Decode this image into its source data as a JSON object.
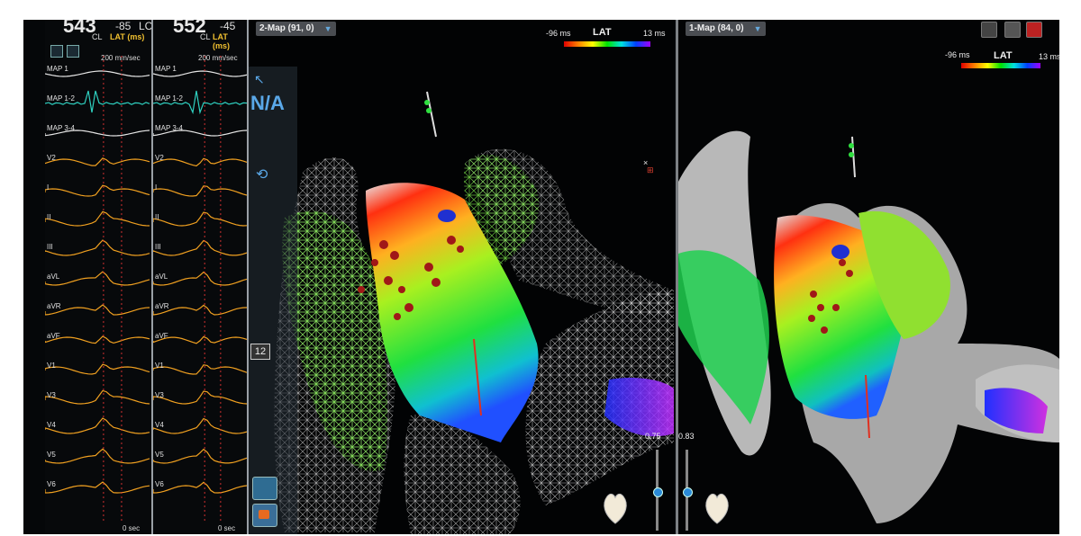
{
  "ecg_left": {
    "big": "543",
    "small": "-85",
    "extra": "LC",
    "cl": "CL",
    "lat": "LAT (ms)",
    "speed": "200 mm/sec",
    "leads": [
      "MAP 1",
      "MAP 1-2",
      "MAP 3-4",
      "V2",
      "I",
      "II",
      "III",
      "aVL",
      "aVR",
      "aVF",
      "V1",
      "V3",
      "V4",
      "V5",
      "V6"
    ],
    "time": "0 sec"
  },
  "ecg_right": {
    "big": "552",
    "small": "-45",
    "cl": "CL",
    "lat": "LAT (ms)",
    "speed": "200 mm/sec",
    "leads": [
      "MAP 1",
      "MAP 1-2",
      "MAP 3-4",
      "V2",
      "I",
      "II",
      "III",
      "aVL",
      "aVR",
      "aVF",
      "V1",
      "V3",
      "V4",
      "V5",
      "V6"
    ],
    "time": "0 sec"
  },
  "map2": {
    "title": "2-Map (91, 0)",
    "legend_min": "-96 ms",
    "legend_label": "LAT",
    "legend_max": "13 ms",
    "na_label": "N/A",
    "count": "12",
    "opacity": "0.75"
  },
  "map1": {
    "title": "1-Map (84, 0)",
    "legend_min": "-96 ms",
    "legend_label": "LAT",
    "legend_max": "13 ms",
    "opacity": "0.83"
  },
  "colors": {
    "wave_white": "#e6e6e6",
    "wave_cyan": "#2fd0c0",
    "wave_orange": "#f0a020",
    "marker_red": "#d03030",
    "accent_blue": "#3a8fd8"
  }
}
